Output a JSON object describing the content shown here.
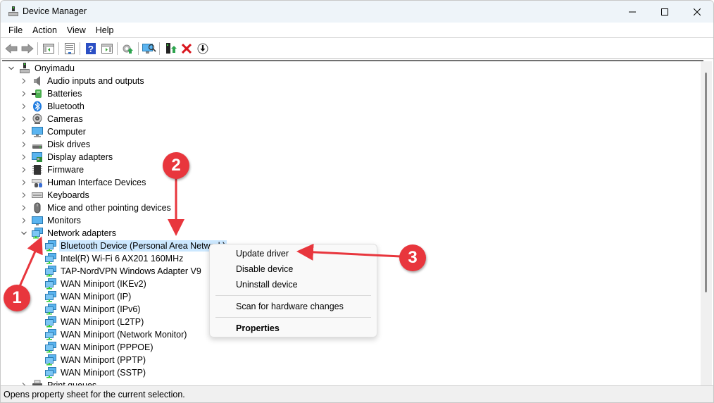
{
  "window": {
    "title": "Device Manager",
    "controls": {
      "minimize": "minimize-icon",
      "maximize": "maximize-icon",
      "close": "close-icon"
    }
  },
  "menubar": {
    "items": [
      {
        "label": "File"
      },
      {
        "label": "Action"
      },
      {
        "label": "View"
      },
      {
        "label": "Help"
      }
    ]
  },
  "toolbar": {
    "buttons": [
      {
        "name": "back",
        "icon": "arrow-left-icon"
      },
      {
        "name": "forward",
        "icon": "arrow-right-icon"
      },
      {
        "name": "show-hide-console-tree",
        "icon": "console-tree-icon"
      },
      {
        "name": "properties",
        "icon": "properties-icon"
      },
      {
        "name": "help",
        "icon": "help-icon"
      },
      {
        "name": "show-action-pane",
        "icon": "action-pane-icon"
      },
      {
        "name": "update-driver",
        "icon": "update-driver-icon"
      },
      {
        "name": "scan-hardware",
        "icon": "scan-hardware-icon"
      },
      {
        "name": "enable-device",
        "icon": "enable-device-icon"
      },
      {
        "name": "uninstall-device",
        "icon": "uninstall-icon"
      },
      {
        "name": "disable-device",
        "icon": "disable-icon"
      }
    ]
  },
  "tree": {
    "root": {
      "label": "Onyimadu",
      "expanded": true
    },
    "categories": [
      {
        "label": "Audio inputs and outputs",
        "icon": "speaker-icon"
      },
      {
        "label": "Batteries",
        "icon": "battery-icon"
      },
      {
        "label": "Bluetooth",
        "icon": "bluetooth-icon"
      },
      {
        "label": "Cameras",
        "icon": "camera-icon"
      },
      {
        "label": "Computer",
        "icon": "computer-icon"
      },
      {
        "label": "Disk drives",
        "icon": "disk-drive-icon"
      },
      {
        "label": "Display adapters",
        "icon": "display-adapter-icon"
      },
      {
        "label": "Firmware",
        "icon": "firmware-icon"
      },
      {
        "label": "Human Interface Devices",
        "icon": "hid-icon"
      },
      {
        "label": "Keyboards",
        "icon": "keyboard-icon"
      },
      {
        "label": "Mice and other pointing devices",
        "icon": "mouse-icon"
      },
      {
        "label": "Monitors",
        "icon": "monitor-icon"
      },
      {
        "label": "Network adapters",
        "icon": "network-adapter-icon",
        "expanded": true
      }
    ],
    "network_adapters": [
      {
        "label": "Bluetooth Device (Personal Area Network)",
        "selected": true
      },
      {
        "label": "Intel(R) Wi-Fi 6 AX201 160MHz"
      },
      {
        "label": "TAP-NordVPN Windows Adapter V9"
      },
      {
        "label": "WAN Miniport (IKEv2)"
      },
      {
        "label": "WAN Miniport (IP)"
      },
      {
        "label": "WAN Miniport (IPv6)"
      },
      {
        "label": "WAN Miniport (L2TP)"
      },
      {
        "label": "WAN Miniport (Network Monitor)"
      },
      {
        "label": "WAN Miniport (PPPOE)"
      },
      {
        "label": "WAN Miniport (PPTP)"
      },
      {
        "label": "WAN Miniport (SSTP)"
      }
    ],
    "after": [
      {
        "label": "Print queues",
        "icon": "printer-icon"
      }
    ]
  },
  "context_menu": {
    "items": [
      {
        "label": "Update driver"
      },
      {
        "label": "Disable device"
      },
      {
        "label": "Uninstall device"
      },
      {
        "label": "Scan for hardware changes"
      },
      {
        "label": "Properties",
        "bold": true
      }
    ]
  },
  "annotations": [
    {
      "number": "1"
    },
    {
      "number": "2"
    },
    {
      "number": "3"
    }
  ],
  "statusbar": {
    "text": "Opens property sheet for the current selection."
  },
  "colors": {
    "annotation": "#e8363d",
    "selection": "#cce8ff",
    "titlebar": "#eef4f9"
  }
}
